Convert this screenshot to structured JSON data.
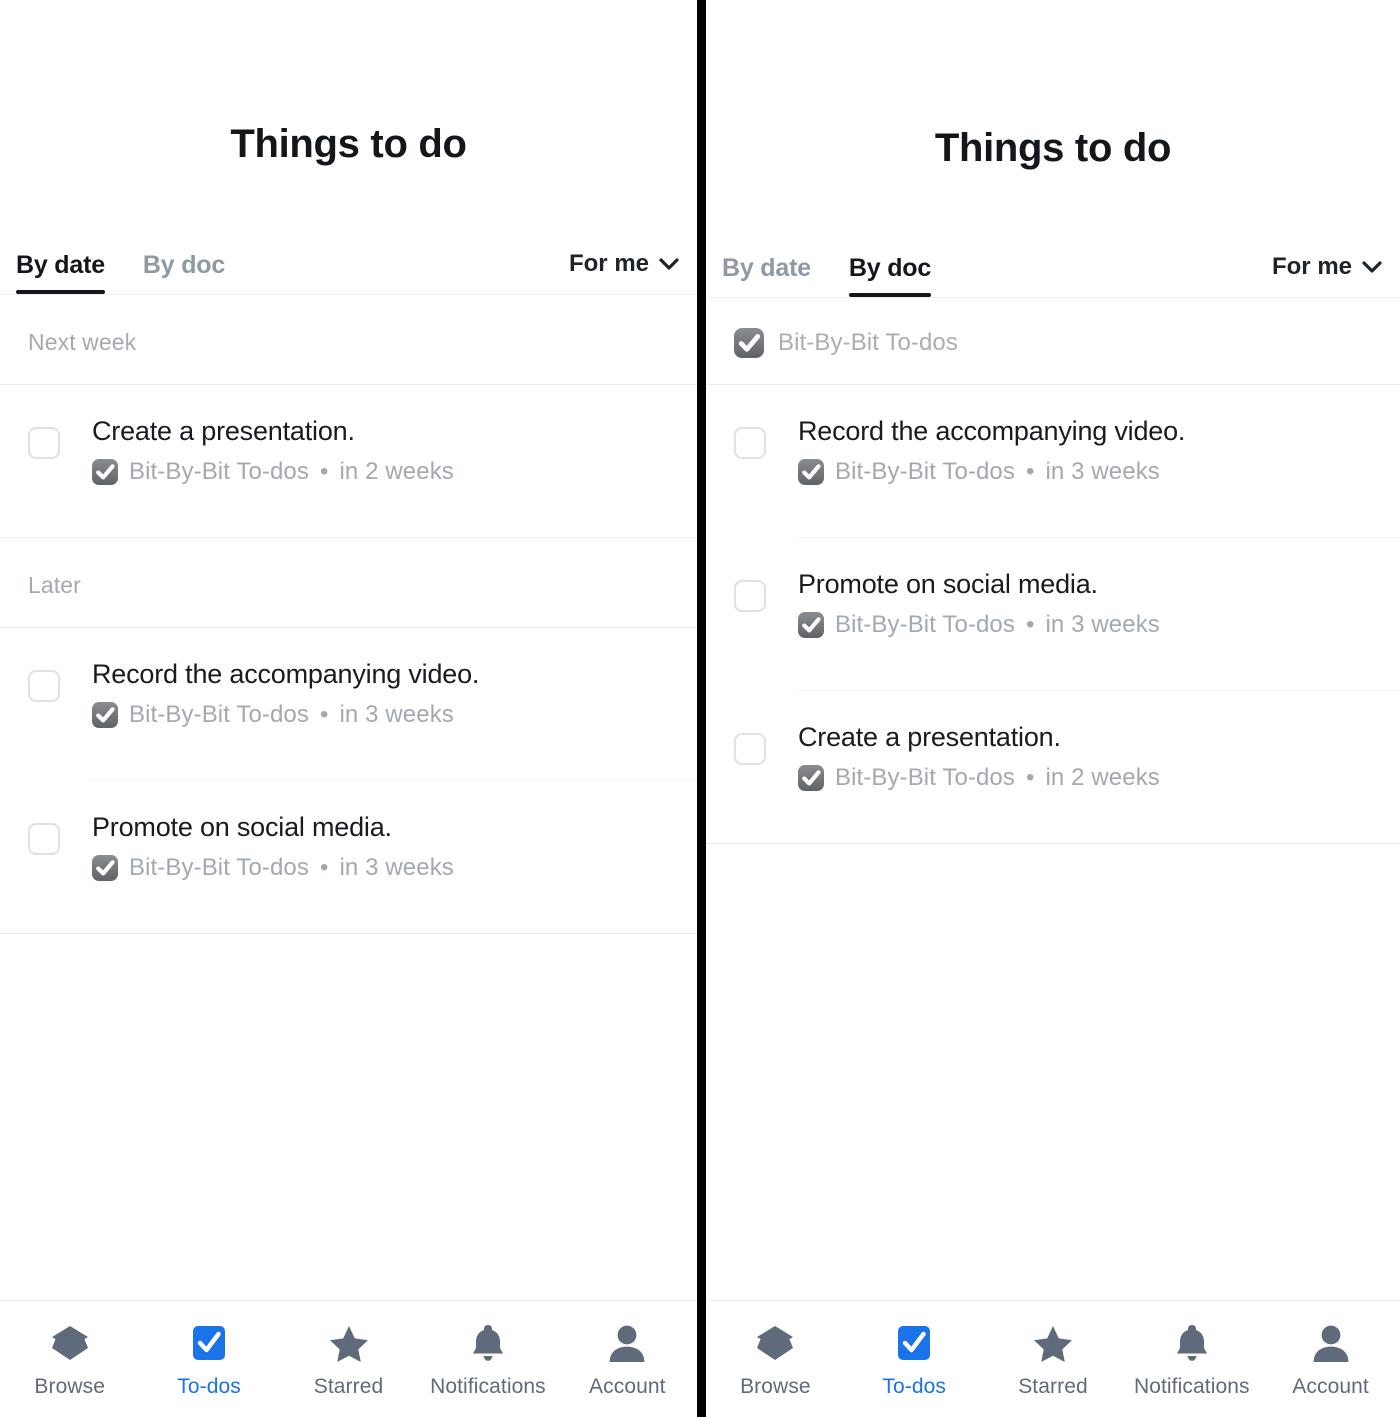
{
  "colors": {
    "accent": "#1a73e8",
    "title": "#13171c",
    "muted": "#a3a9b1",
    "tab_inactive": "#8e99a5",
    "doc_icon": "#6f7378",
    "divider": "#eceef0",
    "panel_split": "#000000"
  },
  "panels": [
    {
      "id": "left",
      "header": {
        "title": "Things to do"
      },
      "tabs": [
        {
          "label": "By date",
          "active": true,
          "name": "tab-by-date"
        },
        {
          "label": "By doc",
          "active": false,
          "name": "tab-by-doc"
        }
      ],
      "scope": {
        "label": "For me",
        "icon": "chevron-down-icon"
      },
      "groups": [
        {
          "type": "date",
          "heading": "Next week",
          "tasks": [
            {
              "title": "Create a presentation.",
              "doc": "Bit-By-Bit To-dos",
              "separator": "•",
              "due": "in 2 weeks",
              "checked": false
            }
          ]
        },
        {
          "type": "date",
          "heading": "Later",
          "tasks": [
            {
              "title": "Record the accompanying video.",
              "doc": "Bit-By-Bit To-dos",
              "separator": "•",
              "due": "in 3 weeks",
              "checked": false
            },
            {
              "title": "Promote on social media.",
              "doc": "Bit-By-Bit To-dos",
              "separator": "•",
              "due": "in 3 weeks",
              "checked": false
            }
          ]
        }
      ],
      "nav": [
        {
          "label": "Browse",
          "icon": "layers-icon",
          "active": false
        },
        {
          "label": "To-dos",
          "icon": "checkbox-icon",
          "active": true
        },
        {
          "label": "Starred",
          "icon": "star-icon",
          "active": false
        },
        {
          "label": "Notifications",
          "icon": "bell-icon",
          "active": false
        },
        {
          "label": "Account",
          "icon": "person-icon",
          "active": false
        }
      ]
    },
    {
      "id": "right",
      "header": {
        "title": "Things to do"
      },
      "tabs": [
        {
          "label": "By date",
          "active": false,
          "name": "tab-by-date"
        },
        {
          "label": "By doc",
          "active": true,
          "name": "tab-by-doc"
        }
      ],
      "scope": {
        "label": "For me",
        "icon": "chevron-down-icon"
      },
      "groups": [
        {
          "type": "doc",
          "heading": "Bit-By-Bit To-dos",
          "heading_icon": "doc-check-icon",
          "tasks": [
            {
              "title": "Record the accompanying video.",
              "doc": "Bit-By-Bit To-dos",
              "separator": "•",
              "due": "in 3 weeks",
              "checked": false
            },
            {
              "title": "Promote on social media.",
              "doc": "Bit-By-Bit To-dos",
              "separator": "•",
              "due": "in 3 weeks",
              "checked": false
            },
            {
              "title": "Create a presentation.",
              "doc": "Bit-By-Bit To-dos",
              "separator": "•",
              "due": "in 2 weeks",
              "checked": false
            }
          ]
        }
      ],
      "nav": [
        {
          "label": "Browse",
          "icon": "layers-icon",
          "active": false
        },
        {
          "label": "To-dos",
          "icon": "checkbox-icon",
          "active": true
        },
        {
          "label": "Starred",
          "icon": "star-icon",
          "active": false
        },
        {
          "label": "Notifications",
          "icon": "bell-icon",
          "active": false
        },
        {
          "label": "Account",
          "icon": "person-icon",
          "active": false
        }
      ]
    }
  ]
}
